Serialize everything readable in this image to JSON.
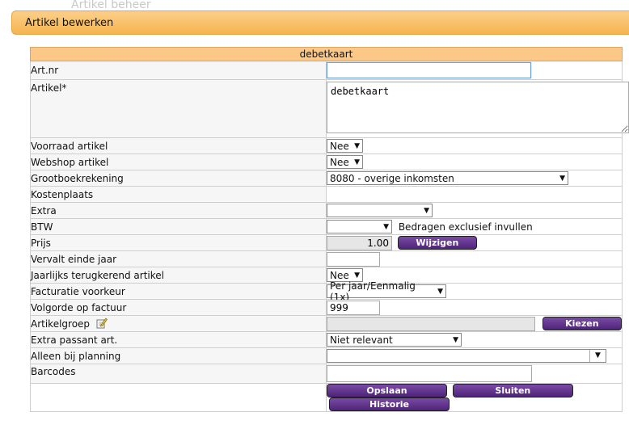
{
  "background": {
    "ghost_title": "Artikel beheer"
  },
  "panel": {
    "title": "Artikel bewerken"
  },
  "form": {
    "caption": "debetkaart",
    "fields": {
      "artnr": {
        "label": "Art.nr",
        "value": ""
      },
      "artikel": {
        "label": "Artikel*",
        "value": "debetkaart"
      },
      "voorraad": {
        "label": "Voorraad artikel",
        "value": "Nee"
      },
      "webshop": {
        "label": "Webshop artikel",
        "value": "Nee"
      },
      "grootboek": {
        "label": "Grootboekrekening",
        "value": "8080 - overige inkomsten"
      },
      "kostenplaats": {
        "label": "Kostenplaats"
      },
      "extra": {
        "label": "Extra",
        "value": ""
      },
      "btw": {
        "label": "BTW",
        "value": "",
        "note": "Bedragen exclusief invullen"
      },
      "prijs": {
        "label": "Prijs",
        "value": "1.00",
        "button": "Wijzigen"
      },
      "vervalt": {
        "label": "Vervalt einde jaar",
        "value": ""
      },
      "jaarlijks": {
        "label": "Jaarlijks terugkerend artikel",
        "value": "Nee"
      },
      "facturatie": {
        "label": "Facturatie voorkeur",
        "value": "Per jaar/Eenmalig (1x)"
      },
      "volgorde": {
        "label": "Volgorde op factuur",
        "value": "999"
      },
      "artikelgroep": {
        "label": "Artikelgroep",
        "value": "",
        "button": "Kiezen"
      },
      "passant": {
        "label": "Extra passant art.",
        "value": "Niet relevant"
      },
      "planning": {
        "label": "Alleen bij planning",
        "value": ""
      },
      "barcodes": {
        "label": "Barcodes",
        "value": ""
      }
    },
    "actions": {
      "save": "Opslaan",
      "close": "Sluiten",
      "history": "Historie"
    }
  },
  "icons": {
    "edit": "edit-pencil-icon",
    "dropdown": "chevron-down-icon"
  },
  "colors": {
    "header": "#f6b450",
    "caption": "#fbc888",
    "button": "#5a2d86"
  }
}
